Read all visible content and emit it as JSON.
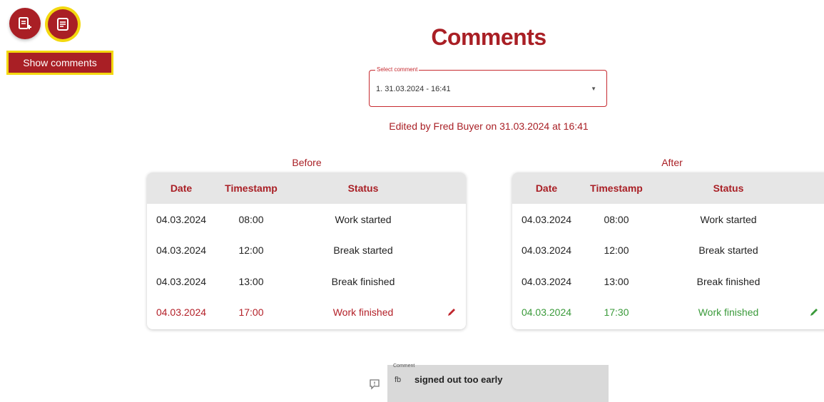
{
  "fabs": {
    "add_comment_icon": "add-comment-icon",
    "show_comments_icon": "comments-icon",
    "tooltip": "Show comments"
  },
  "page_title": "Comments",
  "select": {
    "label": "Select comment",
    "value": "1. 31.03.2024 - 16:41"
  },
  "edited_info": "Edited by Fred Buyer on 31.03.2024 at 16:41",
  "columns": [
    "Date",
    "Timestamp",
    "Status"
  ],
  "before": {
    "title": "Before",
    "rows": [
      {
        "date": "04.03.2024",
        "time": "08:00",
        "status": "Work started"
      },
      {
        "date": "04.03.2024",
        "time": "12:00",
        "status": "Break started"
      },
      {
        "date": "04.03.2024",
        "time": "13:00",
        "status": "Break finished"
      },
      {
        "date": "04.03.2024",
        "time": "17:00",
        "status": "Work finished"
      }
    ]
  },
  "after": {
    "title": "After",
    "rows": [
      {
        "date": "04.03.2024",
        "time": "08:00",
        "status": "Work started"
      },
      {
        "date": "04.03.2024",
        "time": "12:00",
        "status": "Break started"
      },
      {
        "date": "04.03.2024",
        "time": "13:00",
        "status": "Break finished"
      },
      {
        "date": "04.03.2024",
        "time": "17:30",
        "status": "Work finished"
      }
    ]
  },
  "comment": {
    "label": "Comment",
    "initials": "fb",
    "text": "signed out too early"
  },
  "colors": {
    "brand": "#a91f25",
    "highlight": "#f3d80f",
    "changed_before": "#b31f27",
    "changed_after": "#3a9a3a"
  }
}
